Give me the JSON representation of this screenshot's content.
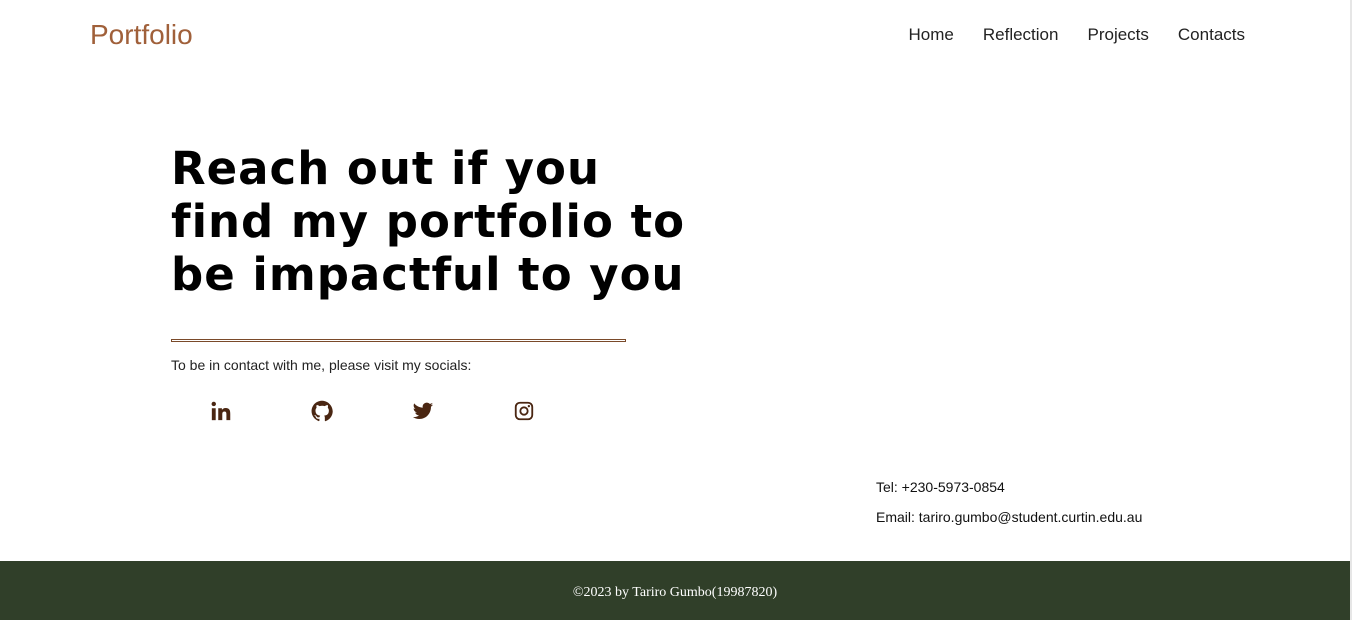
{
  "header": {
    "brand": "Portfolio",
    "nav": [
      {
        "label": "Home"
      },
      {
        "label": "Reflection"
      },
      {
        "label": "Projects"
      },
      {
        "label": "Contacts"
      }
    ]
  },
  "main": {
    "headline": "Reach out if you find my portfolio to be impactful to you",
    "socials_text": "To be in contact with me, please visit my socials:",
    "socials": [
      {
        "icon": "linkedin-icon"
      },
      {
        "icon": "github-icon"
      },
      {
        "icon": "twitter-icon"
      },
      {
        "icon": "instagram-icon"
      }
    ],
    "tel": "Tel: +230-5973-0854",
    "email": "Email: tariro.gumbo@student.curtin.edu.au"
  },
  "footer": {
    "text": "©2023 by Tariro Gumbo(19987820)"
  },
  "colors": {
    "brand": "#a0603a",
    "icon": "#4a2612",
    "footer_bg": "#303f29"
  }
}
